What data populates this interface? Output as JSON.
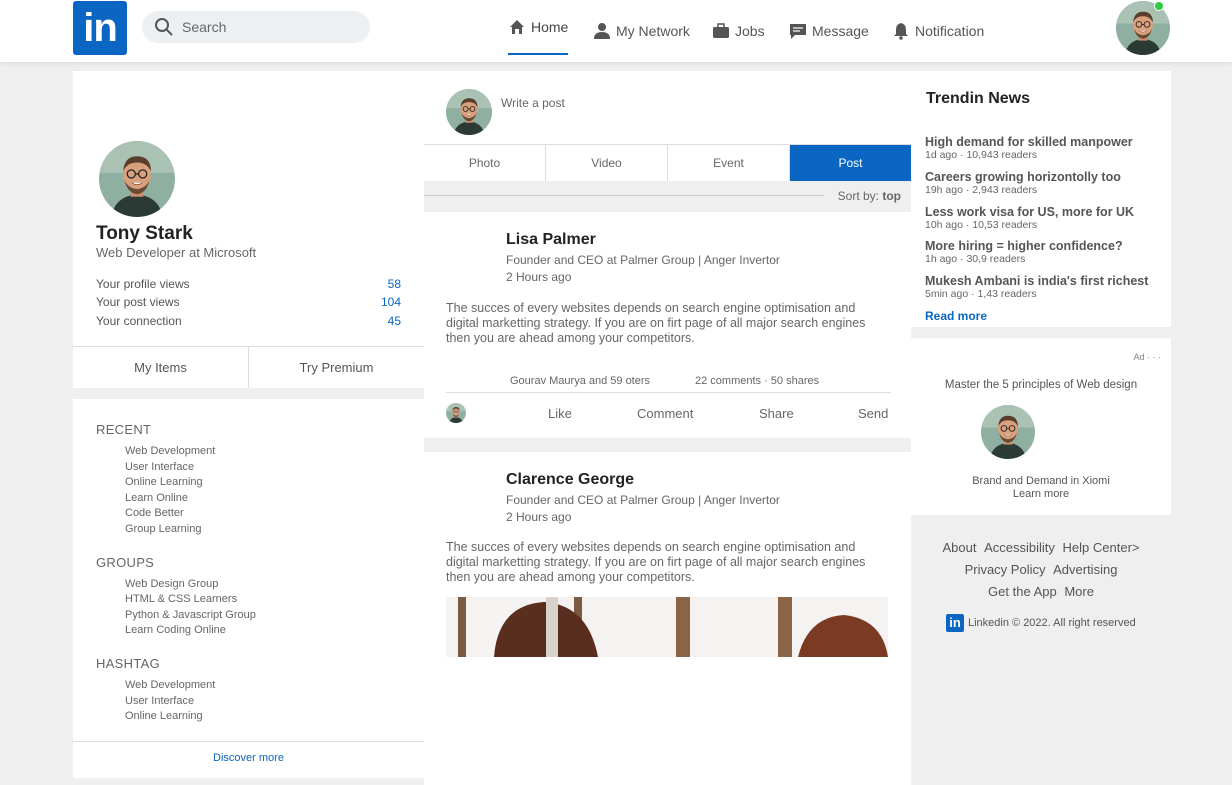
{
  "header": {
    "logo_text": "in",
    "search_placeholder": "Search",
    "nav": [
      {
        "label": "Home",
        "icon": "home-icon"
      },
      {
        "label": "My Network",
        "icon": "person-icon"
      },
      {
        "label": "Jobs",
        "icon": "briefcase-icon"
      },
      {
        "label": "Message",
        "icon": "chat-icon"
      },
      {
        "label": "Notification",
        "icon": "bell-icon"
      }
    ],
    "active_nav": "Home",
    "accent_color": "#0a66c2",
    "online_color": "#2ecc40"
  },
  "profile": {
    "name": "Tony Stark",
    "role": "Web Developer at Microsoft",
    "stats": [
      {
        "label": "Your profile views",
        "value": "58"
      },
      {
        "label": "Your post views",
        "value": "104"
      },
      {
        "label": "Your connection",
        "value": "45"
      }
    ],
    "buttons": [
      "My Items",
      "Try Premium"
    ]
  },
  "sidebar": {
    "recent_title": "RECENT",
    "recent": [
      "Web Development",
      "User Interface",
      "Online Learning",
      "Learn Online",
      "Code Better",
      "Group Learning"
    ],
    "groups_title": "GROUPS",
    "groups": [
      "Web Design Group",
      "HTML & CSS Learners",
      "Python & Javascript Group",
      "Learn Coding Online"
    ],
    "hashtag_title": "HASHTAG",
    "hashtags": [
      "Web Development",
      "User Interface",
      "Online Learning"
    ],
    "discover": "Discover more"
  },
  "composer": {
    "placeholder": "Write a post",
    "tabs": [
      "Photo",
      "Video",
      "Event",
      "Post"
    ],
    "active_tab": "Post",
    "sort_label": "Sort by:",
    "sort_value": "top"
  },
  "posts": [
    {
      "author": "Lisa Palmer",
      "title": "Founder and CEO at Palmer Group | Anger Invertor",
      "time": "2 Hours ago",
      "body": "The succes of every websites depends on search engine optimisation and digital marketting strategy. If you are on firt page of all major search engines then you are ahead among your competitors.",
      "likes": "Gourav Maurya and 59 oters",
      "stats": "22 comments · 50 shares",
      "actions": [
        "Like",
        "Comment",
        "Share",
        "Send"
      ]
    },
    {
      "author": "Clarence George",
      "title": "Founder and CEO at Palmer Group | Anger Invertor",
      "time": "2 Hours ago",
      "body": "The succes of every websites depends on search engine optimisation and digital marketting strategy. If you are on firt page of all major search engines then you are ahead among your competitors."
    }
  ],
  "trending": {
    "title": "Trendin News",
    "items": [
      {
        "headline": "High demand for skilled manpower",
        "sub": "1d ago · 10,943 readers"
      },
      {
        "headline": "Careers growing horizontolly too",
        "sub": "19h ago · 2,943 readers"
      },
      {
        "headline": "Less work visa for US, more for UK",
        "sub": "10h ago · 10,53 readers"
      },
      {
        "headline": "More hiring = higher confidence?",
        "sub": "1h ago · 30,9 readers"
      },
      {
        "headline": "Mukesh Ambani is india's first richest",
        "sub": "5min ago · 1,43 readers"
      }
    ],
    "read_more": "Read more"
  },
  "ad": {
    "label": "Ad · · ·",
    "title": "Master the 5 principles of Web design",
    "brand": "Brand and Demand in Xiomi",
    "learn": "Learn more"
  },
  "footer": {
    "rows": [
      [
        "About",
        "Accessibility",
        "Help Center>"
      ],
      [
        "Privacy Policy",
        "Advertising"
      ],
      [
        "Get the App",
        "More"
      ]
    ],
    "logo_text": "in",
    "copyright": "Linkedin © 2022. All right reserved"
  }
}
